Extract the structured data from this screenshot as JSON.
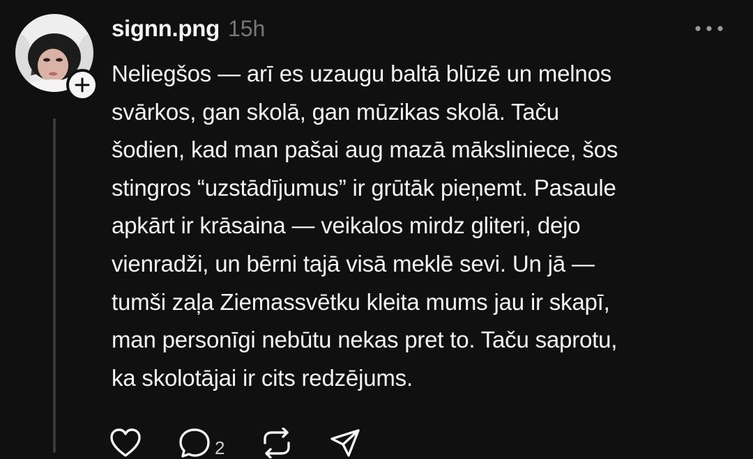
{
  "post": {
    "username": "signn.png",
    "time": "15h",
    "text": "Neliegšos — arī es uzaugu baltā blūzē un melnos\nsvārkos, gan skolā, gan mūzikas skolā. Taču\nšodien, kad man pašai aug mazā māksliniece, šos\nstingros “uzstādījumus” ir grūtāk pieņemt. Pasaule\napkārt ir krāsaina — veikalos mirdz gliteri, dejo\nvienradži, un bērni tajā visā meklē sevi. Un jā —\ntumši zaļa Ziemassvētku kleita mums jau ir skapī,\nman personīgi nebūtu nekas pret to. Taču saprotu,\nka skolotājai ir cits redzējums."
  },
  "icons": {
    "follow": "plus-icon",
    "more": "more-horizontal-icon",
    "like": "heart-icon",
    "reply": "comment-icon",
    "repost": "repost-icon",
    "share": "share-icon"
  },
  "actions": {
    "reply_count": "2"
  },
  "colors": {
    "background": "#101010",
    "text": "#f3f5f7",
    "muted": "#777777",
    "thread_line": "#3a3a3a"
  }
}
